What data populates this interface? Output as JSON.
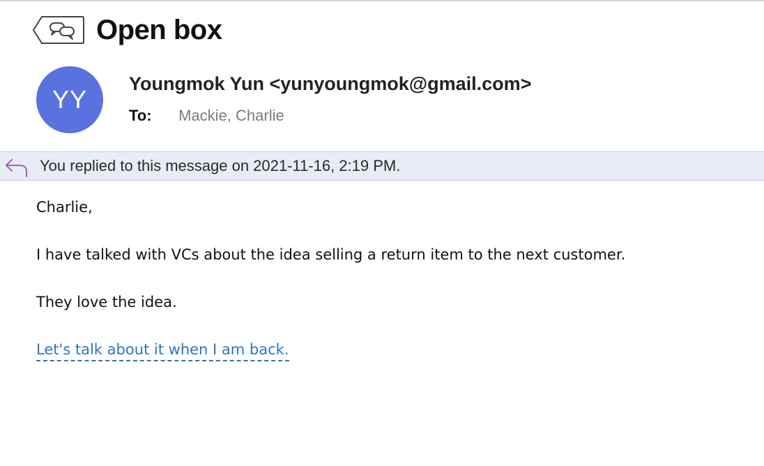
{
  "message": {
    "subject": "Open box",
    "sender": {
      "initials": "YY",
      "display": "Youngmok Yun <yunyoungmok@gmail.com>",
      "avatar_color": "#5a72e0"
    },
    "recipients": {
      "label": "To:",
      "value": "Mackie, Charlie"
    },
    "reply_notice": "You replied to this message on 2021-11-16, 2:19 PM.",
    "body": {
      "greeting": "Charlie,",
      "paragraph_1": "I have talked with VCs about the idea selling a return item to the next customer.",
      "paragraph_2": "They love the idea.",
      "link_text": "Let's talk about it when I am back."
    }
  },
  "icons": {
    "back": "conversation-back-icon",
    "reply": "reply-arrow-icon"
  },
  "colors": {
    "banner_bg": "#e8ecf4",
    "link": "#2f74c0",
    "reply_icon": "#9a4fb0"
  }
}
